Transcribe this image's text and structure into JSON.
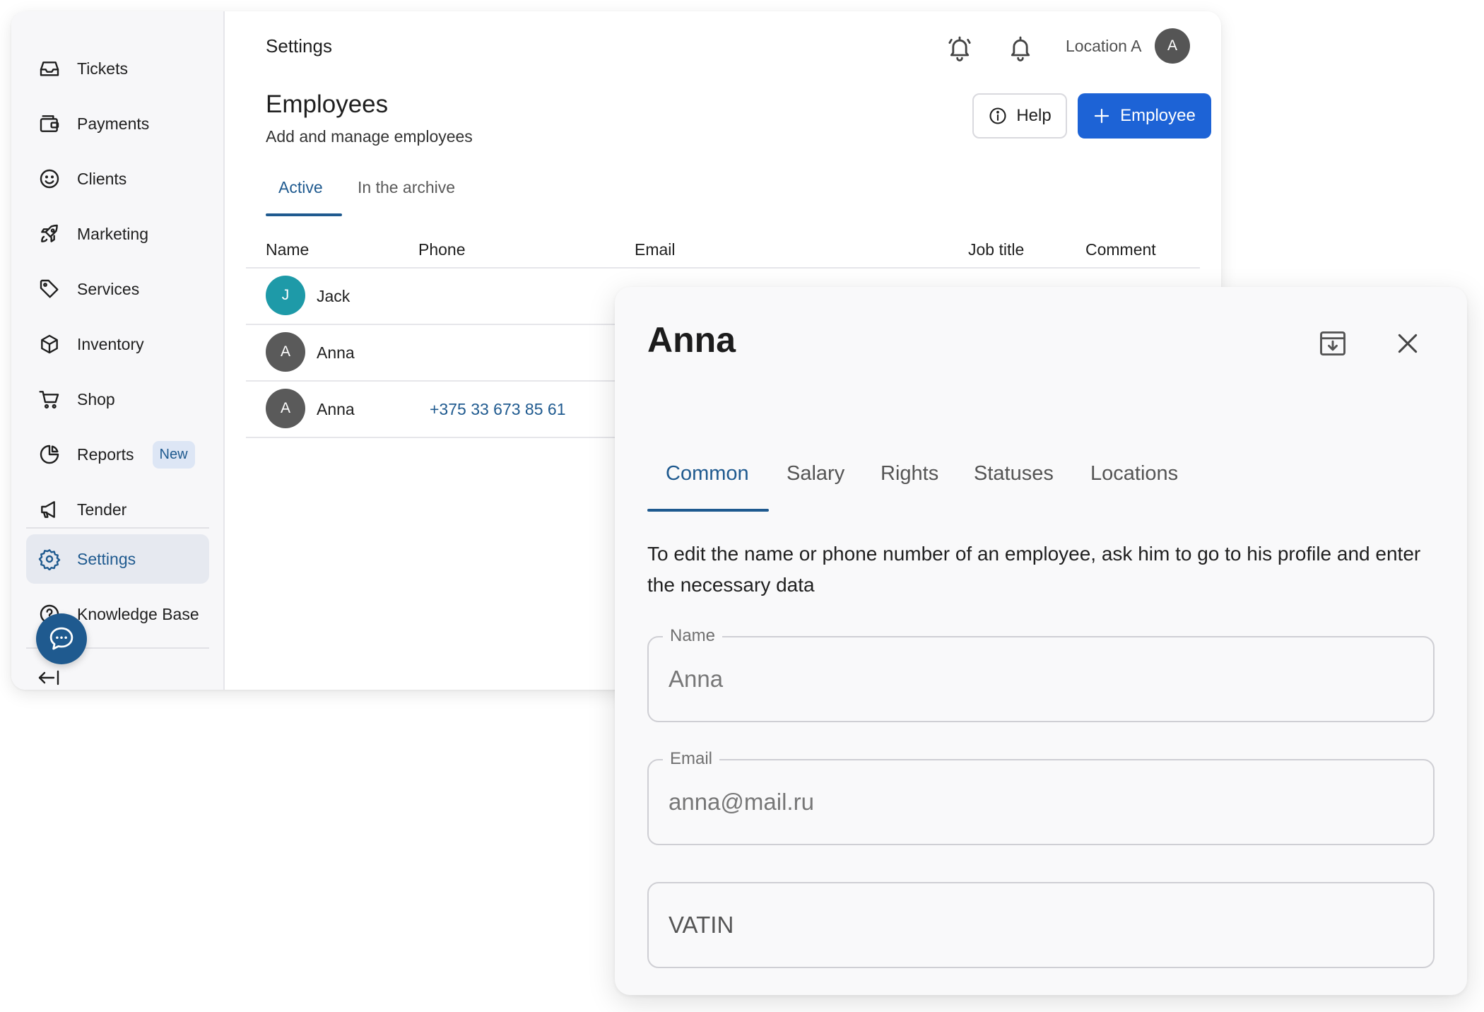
{
  "sidebar": {
    "items": [
      {
        "label": "Tickets",
        "icon": "inbox-icon"
      },
      {
        "label": "Payments",
        "icon": "wallet-icon"
      },
      {
        "label": "Clients",
        "icon": "smile-icon"
      },
      {
        "label": "Marketing",
        "icon": "rocket-icon"
      },
      {
        "label": "Services",
        "icon": "tag-icon"
      },
      {
        "label": "Inventory",
        "icon": "box-icon"
      },
      {
        "label": "Shop",
        "icon": "cart-icon"
      },
      {
        "label": "Reports",
        "icon": "pie-chart-icon",
        "badge": "New"
      },
      {
        "label": "Tender",
        "icon": "megaphone-icon"
      },
      {
        "label": "Settings",
        "icon": "gear-icon",
        "active": true
      },
      {
        "label": "Knowledge Base",
        "icon": "help-circle-icon"
      }
    ]
  },
  "header": {
    "title": "Settings",
    "location": "Location A",
    "avatar_initial": "A"
  },
  "page": {
    "title": "Employees",
    "subtitle": "Add and manage employees",
    "help_label": "Help",
    "add_label": "Employee",
    "tabs": [
      {
        "label": "Active",
        "active": true
      },
      {
        "label": "In the archive",
        "active": false
      }
    ]
  },
  "table": {
    "columns": [
      "Name",
      "Phone",
      "Email",
      "Job title",
      "Comment"
    ],
    "rows": [
      {
        "initial": "J",
        "name": "Jack",
        "phone": "",
        "avatar_color": "#1e9aa8"
      },
      {
        "initial": "A",
        "name": "Anna",
        "phone": "",
        "avatar_color": "#5a5a5a"
      },
      {
        "initial": "A",
        "name": "Anna",
        "phone": "+375 33 673 85 61",
        "avatar_color": "#5a5a5a"
      }
    ]
  },
  "card": {
    "title": "Anna",
    "tabs": [
      {
        "label": "Common",
        "active": true
      },
      {
        "label": "Salary",
        "active": false
      },
      {
        "label": "Rights",
        "active": false
      },
      {
        "label": "Statuses",
        "active": false
      },
      {
        "label": "Locations",
        "active": false
      }
    ],
    "hint": "To edit the name or phone number of an employee, ask him to go to his profile and enter the necessary data",
    "fields": {
      "name": {
        "label": "Name",
        "value": "Anna"
      },
      "email": {
        "label": "Email",
        "value": "anna@mail.ru"
      },
      "vatin": {
        "placeholder": "VATIN"
      }
    }
  },
  "colors": {
    "accent": "#1f5a8f",
    "primary_button": "#1d63d6",
    "active_nav_bg": "#e6e9f0"
  }
}
